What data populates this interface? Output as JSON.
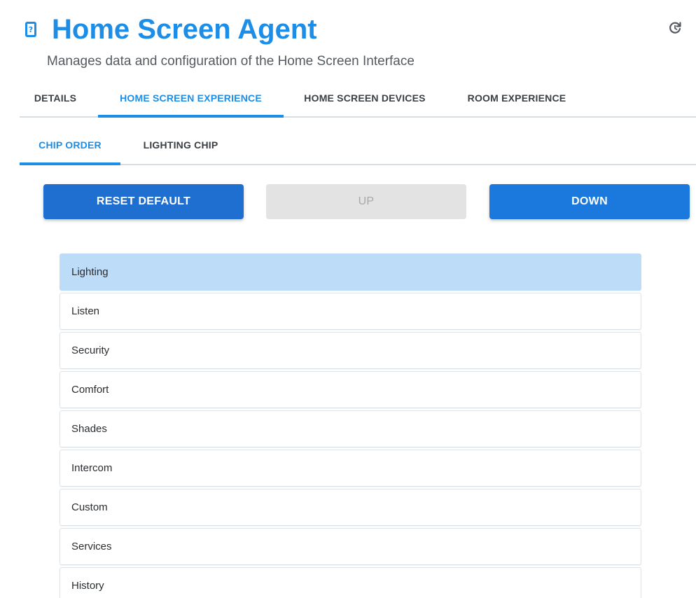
{
  "header": {
    "title": "Home Screen Agent",
    "subtitle": "Manages data and configuration of the Home Screen Interface",
    "app_icon": "help-device-icon",
    "refresh_icon": "refresh-icon"
  },
  "tabs": {
    "main": [
      {
        "label": "DETAILS",
        "active": false
      },
      {
        "label": "HOME SCREEN EXPERIENCE",
        "active": true
      },
      {
        "label": "HOME SCREEN DEVICES",
        "active": false
      },
      {
        "label": "ROOM EXPERIENCE",
        "active": false
      }
    ],
    "sub": [
      {
        "label": "CHIP ORDER",
        "active": true
      },
      {
        "label": "LIGHTING CHIP",
        "active": false
      }
    ]
  },
  "buttons": {
    "reset": "RESET DEFAULT",
    "up": "UP",
    "down": "DOWN"
  },
  "chip_list": {
    "items": [
      "Lighting",
      "Listen",
      "Security",
      "Comfort",
      "Shades",
      "Intercom",
      "Custom",
      "Services",
      "History"
    ],
    "selected": "Lighting"
  },
  "colors": {
    "accent": "#1c8ee8",
    "button_primary": "#1f6fd0",
    "selected_row": "#bcdcf8",
    "disabled_button": "#e3e3e3"
  }
}
